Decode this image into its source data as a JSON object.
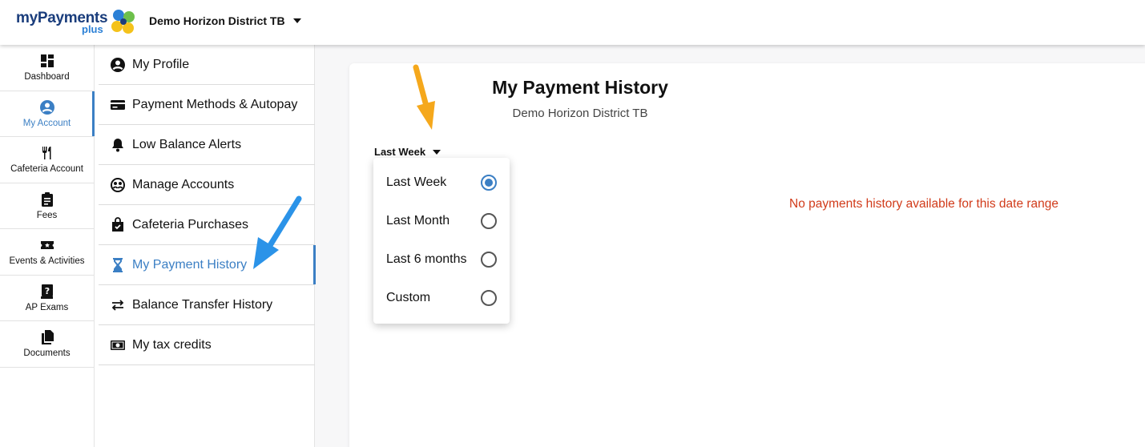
{
  "header": {
    "logo_main": "myPayments",
    "logo_sub": "plus",
    "district": "Demo Horizon District TB"
  },
  "rail": {
    "items": [
      {
        "label": "Dashboard",
        "icon": "dashboard-icon"
      },
      {
        "label": "My Account",
        "icon": "account-icon",
        "active": true
      },
      {
        "label": "Cafeteria Account",
        "icon": "utensils-icon"
      },
      {
        "label": "Fees",
        "icon": "clipboard-icon"
      },
      {
        "label": "Events & Activities",
        "icon": "ticket-icon"
      },
      {
        "label": "AP Exams",
        "icon": "question-book-icon"
      },
      {
        "label": "Documents",
        "icon": "documents-icon"
      }
    ]
  },
  "submenu": {
    "items": [
      {
        "label": "My Profile",
        "icon": "user-circle-icon"
      },
      {
        "label": "Payment Methods & Autopay",
        "icon": "credit-card-icon"
      },
      {
        "label": "Low Balance Alerts",
        "icon": "bell-icon"
      },
      {
        "label": "Manage Accounts",
        "icon": "users-circle-icon"
      },
      {
        "label": "Cafeteria Purchases",
        "icon": "shopping-bag-icon"
      },
      {
        "label": "My Payment History",
        "icon": "hourglass-icon",
        "active": true
      },
      {
        "label": "Balance Transfer History",
        "icon": "transfer-icon"
      },
      {
        "label": "My tax credits",
        "icon": "money-icon"
      }
    ]
  },
  "main": {
    "title": "My Payment History",
    "subtitle": "Demo Horizon District TB",
    "range_selected": "Last Week",
    "empty_message": "No payments history available for this date range"
  },
  "dropdown": {
    "options": [
      {
        "label": "Last Week",
        "checked": true
      },
      {
        "label": "Last Month",
        "checked": false
      },
      {
        "label": "Last 6 months",
        "checked": false
      },
      {
        "label": "Custom",
        "checked": false
      }
    ]
  },
  "colors": {
    "accent": "#3b7fc4",
    "error": "#d13b1a",
    "arrow_orange": "#f5a81c",
    "arrow_blue": "#2b93e8"
  }
}
